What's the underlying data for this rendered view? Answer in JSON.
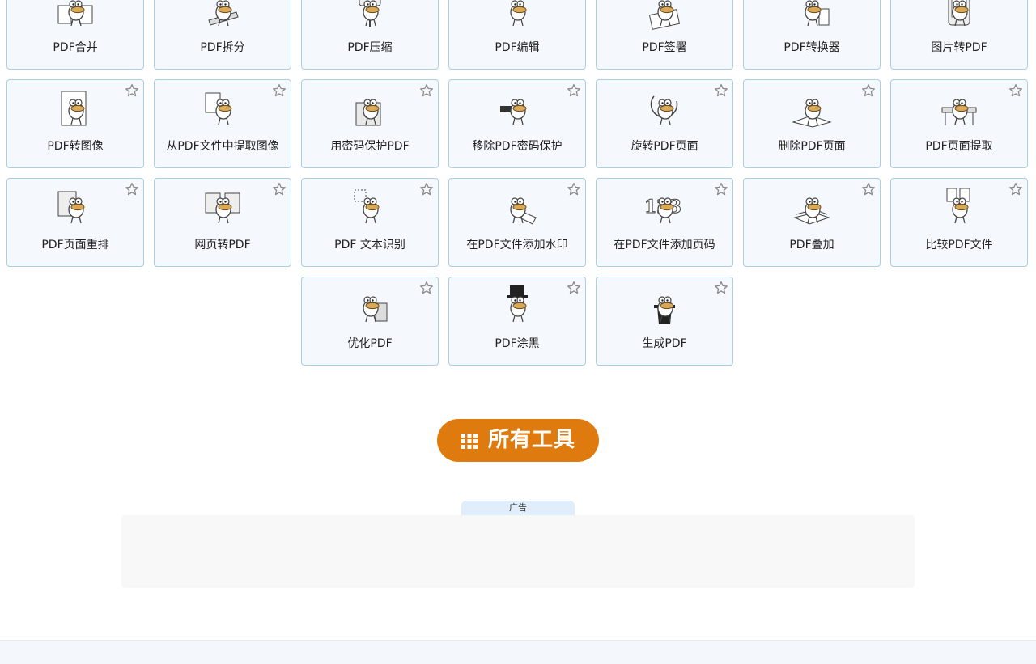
{
  "tools": {
    "row1": [
      {
        "label": "PDF合并",
        "icon": "merge-mascot-icon"
      },
      {
        "label": "PDF拆分",
        "icon": "split-mascot-icon"
      },
      {
        "label": "PDF压缩",
        "icon": "compress-mascot-icon"
      },
      {
        "label": "PDF编辑",
        "icon": "edit-mascot-icon"
      },
      {
        "label": "PDF签署",
        "icon": "sign-mascot-icon"
      },
      {
        "label": "PDF转换器",
        "icon": "convert-mascot-icon"
      },
      {
        "label": "图片转PDF",
        "icon": "image-to-pdf-mascot-icon"
      }
    ],
    "row2": [
      {
        "label": "PDF转图像",
        "icon": "pdf-to-image-mascot-icon"
      },
      {
        "label": "从PDF文件中提取图像",
        "icon": "extract-images-mascot-icon"
      },
      {
        "label": "用密码保护PDF",
        "icon": "protect-safe-mascot-icon"
      },
      {
        "label": "移除PDF密码保护",
        "icon": "unlock-mascot-icon"
      },
      {
        "label": "旋转PDF页面",
        "icon": "rotate-mascot-icon"
      },
      {
        "label": "删除PDF页面",
        "icon": "delete-pages-mascot-icon"
      },
      {
        "label": "PDF页面提取",
        "icon": "extract-pages-mascot-icon"
      }
    ],
    "row3": [
      {
        "label": "PDF页面重排",
        "icon": "reorder-pages-mascot-icon"
      },
      {
        "label": "网页转PDF",
        "icon": "web-to-pdf-mascot-icon"
      },
      {
        "label": "PDF 文本识别",
        "icon": "ocr-mascot-icon"
      },
      {
        "label": "在PDF文件添加水印",
        "icon": "watermark-mascot-icon"
      },
      {
        "label": "在PDF文件添加页码",
        "icon": "page-numbers-mascot-icon"
      },
      {
        "label": "PDF叠加",
        "icon": "overlay-mascot-icon"
      },
      {
        "label": "比较PDF文件",
        "icon": "compare-mascot-icon"
      }
    ],
    "row4": [
      {
        "label": "优化PDF",
        "icon": "optimize-mascot-icon"
      },
      {
        "label": "PDF涂黑",
        "icon": "redact-mascot-icon"
      },
      {
        "label": "生成PDF",
        "icon": "create-top-hat-mascot-icon"
      }
    ]
  },
  "all_tools_button": {
    "label": "所有工具",
    "icon": "grid-icon"
  },
  "ad": {
    "label": "广告"
  },
  "colors": {
    "card_border": "#a9cfe2",
    "card_background": "#f5f8fc",
    "button_orange": "#df7a0f",
    "mascot_beak": "#d9a95a",
    "star_outline": "#8a8a8a"
  }
}
